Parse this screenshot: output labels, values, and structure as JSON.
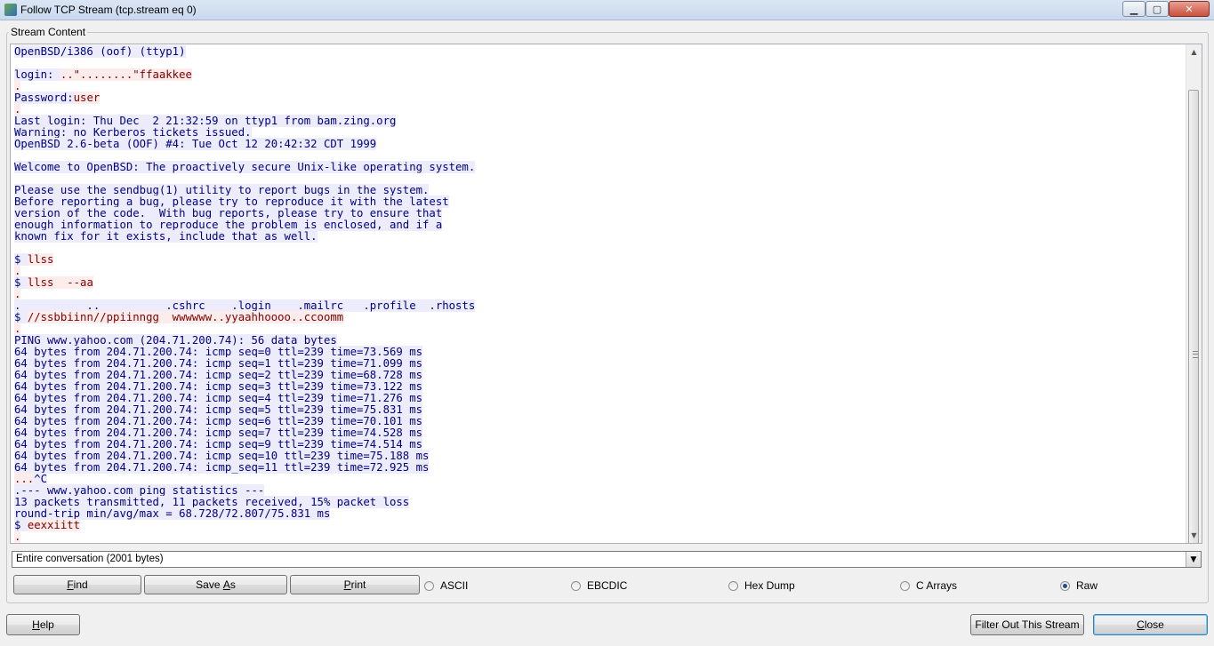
{
  "window": {
    "title": "Follow TCP Stream (tcp.stream eq 0)",
    "min_glyph": "▁",
    "max_glyph": "▢",
    "close_glyph": "✕"
  },
  "group": {
    "legend": "Stream Content"
  },
  "stream_lines": [
    [
      {
        "t": "OpenBSD/i386 (oof) (ttyp1)",
        "c": "s"
      }
    ],
    [],
    [
      {
        "t": "login: ",
        "c": "s"
      },
      {
        "t": "..\"........\"ffaakkee",
        "c": "c"
      }
    ],
    [
      {
        "t": ".",
        "c": "c"
      }
    ],
    [
      {
        "t": "Password:",
        "c": "s"
      },
      {
        "t": "user",
        "c": "c"
      }
    ],
    [
      {
        "t": ".",
        "c": "c"
      }
    ],
    [
      {
        "t": "Last login: Thu Dec  2 21:32:59 on ttyp1 from bam.zing.org",
        "c": "s"
      }
    ],
    [
      {
        "t": "Warning: no Kerberos tickets issued.",
        "c": "s"
      }
    ],
    [
      {
        "t": "OpenBSD 2.6-beta (OOF) #4: Tue Oct 12 20:42:32 CDT 1999",
        "c": "s"
      }
    ],
    [],
    [
      {
        "t": "Welcome to OpenBSD: The proactively secure Unix-like operating system.",
        "c": "s"
      }
    ],
    [],
    [
      {
        "t": "Please use the sendbug(1) utility to report bugs in the system.",
        "c": "s"
      }
    ],
    [
      {
        "t": "Before reporting a bug, please try to reproduce it with the latest",
        "c": "s"
      }
    ],
    [
      {
        "t": "version of the code.  With bug reports, please try to ensure that",
        "c": "s"
      }
    ],
    [
      {
        "t": "enough information to reproduce the problem is enclosed, and if a",
        "c": "s"
      }
    ],
    [
      {
        "t": "known fix for it exists, include that as well.",
        "c": "s"
      }
    ],
    [],
    [
      {
        "t": "$ ",
        "c": "s"
      },
      {
        "t": "llss",
        "c": "c"
      }
    ],
    [
      {
        "t": ".",
        "c": "c"
      }
    ],
    [
      {
        "t": "$ ",
        "c": "s"
      },
      {
        "t": "llss  --aa",
        "c": "c"
      }
    ],
    [
      {
        "t": ".",
        "c": "c"
      }
    ],
    [
      {
        "t": ".          ..          .cshrc    .login    .mailrc   .profile  .rhosts",
        "c": "s"
      }
    ],
    [
      {
        "t": "$ ",
        "c": "s"
      },
      {
        "t": "//ssbbiinn//ppiinngg  wwwwww..yyaahhoooo..ccoomm",
        "c": "c"
      }
    ],
    [
      {
        "t": ".",
        "c": "c"
      }
    ],
    [
      {
        "t": "PING www.yahoo.com (204.71.200.74): 56 data bytes",
        "c": "s"
      }
    ],
    [
      {
        "t": "64 bytes from 204.71.200.74: icmp_seq=0 ttl=239 time=73.569 ms",
        "c": "s"
      }
    ],
    [
      {
        "t": "64 bytes from 204.71.200.74: icmp_seq=1 ttl=239 time=71.099 ms",
        "c": "s"
      }
    ],
    [
      {
        "t": "64 bytes from 204.71.200.74: icmp_seq=2 ttl=239 time=68.728 ms",
        "c": "s"
      }
    ],
    [
      {
        "t": "64 bytes from 204.71.200.74: icmp_seq=3 ttl=239 time=73.122 ms",
        "c": "s"
      }
    ],
    [
      {
        "t": "64 bytes from 204.71.200.74: icmp_seq=4 ttl=239 time=71.276 ms",
        "c": "s"
      }
    ],
    [
      {
        "t": "64 bytes from 204.71.200.74: icmp_seq=5 ttl=239 time=75.831 ms",
        "c": "s"
      }
    ],
    [
      {
        "t": "64 bytes from 204.71.200.74: icmp_seq=6 ttl=239 time=70.101 ms",
        "c": "s"
      }
    ],
    [
      {
        "t": "64 bytes from 204.71.200.74: icmp_seq=7 ttl=239 time=74.528 ms",
        "c": "s"
      }
    ],
    [
      {
        "t": "64 bytes from 204.71.200.74: icmp_seq=9 ttl=239 time=74.514 ms",
        "c": "s"
      }
    ],
    [
      {
        "t": "64 bytes from 204.71.200.74: icmp_seq=10 ttl=239 time=75.188 ms",
        "c": "s"
      }
    ],
    [
      {
        "t": "64 bytes from 204.71.200.74: icmp_seq=11 ttl=239 time=72.925 ms",
        "c": "s"
      }
    ],
    [
      {
        "t": "...",
        "c": "c"
      },
      {
        "t": "^C",
        "c": "s"
      }
    ],
    [
      {
        "t": ".--- www.yahoo.com ping statistics ---",
        "c": "s"
      }
    ],
    [
      {
        "t": "13 packets transmitted, 11 packets received, 15% packet loss",
        "c": "s"
      }
    ],
    [
      {
        "t": "round-trip min/avg/max = 68.728/72.807/75.831 ms",
        "c": "s"
      }
    ],
    [
      {
        "t": "$ ",
        "c": "s"
      },
      {
        "t": "eexxiitt",
        "c": "c"
      }
    ],
    [
      {
        "t": ".",
        "c": "c"
      }
    ]
  ],
  "colors": {
    "server_fg": "#000080",
    "server_bg": "#ececfc",
    "client_fg": "#800000",
    "client_bg": "#fcecec"
  },
  "conversation_select": {
    "value": "Entire conversation (2001 bytes)"
  },
  "buttons": {
    "find": {
      "mnemonic": "F",
      "rest": "ind"
    },
    "save_as": {
      "pre": "Save ",
      "mnemonic": "A",
      "rest": "s"
    },
    "print": {
      "mnemonic": "P",
      "rest": "rint"
    },
    "help": {
      "mnemonic": "H",
      "rest": "elp"
    },
    "filter_out": "Filter Out This Stream",
    "close": {
      "mnemonic": "C",
      "rest": "lose"
    }
  },
  "format_options": [
    {
      "label": "ASCII",
      "selected": false
    },
    {
      "label": "EBCDIC",
      "selected": false
    },
    {
      "label": "Hex Dump",
      "selected": false
    },
    {
      "label": "C Arrays",
      "selected": false
    },
    {
      "label": "Raw",
      "selected": true
    }
  ]
}
